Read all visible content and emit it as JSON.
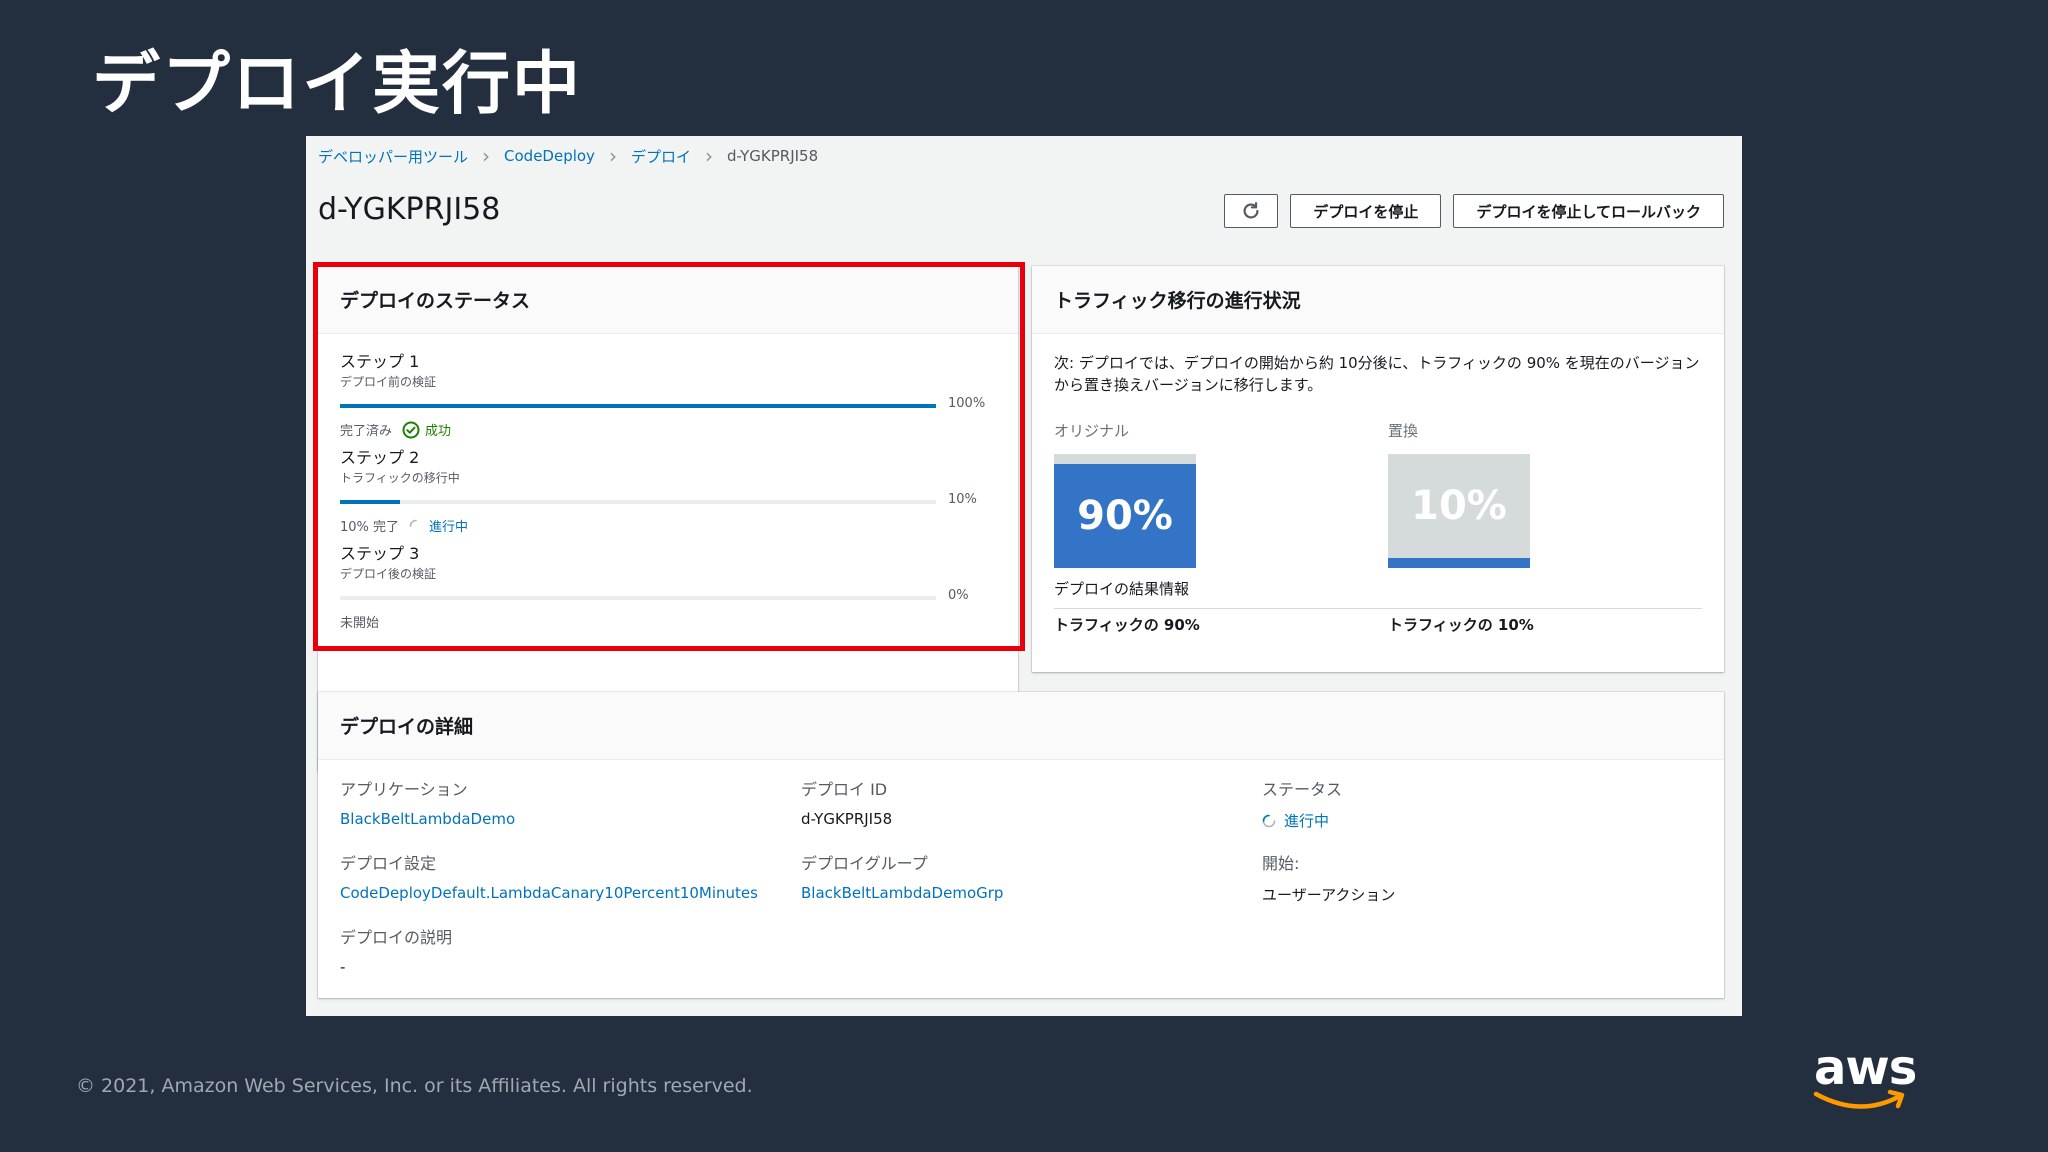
{
  "slide": {
    "title": "デプロイ実行中",
    "copyright": "© 2021, Amazon Web Services, Inc. or its Affiliates. All rights reserved.",
    "logo_text": "aws"
  },
  "breadcrumb": [
    "デベロッパー用ツール",
    "CodeDeploy",
    "デプロイ",
    "d-YGKPRJI58"
  ],
  "page": {
    "title": "d-YGKPRJI58",
    "stop_button": "デプロイを停止",
    "stop_rollback_button": "デプロイを停止してロールバック",
    "refresh_icon": "refresh-icon"
  },
  "status_card": {
    "title": "デプロイのステータス",
    "steps": [
      {
        "name": "ステップ 1",
        "desc": "デプロイ前の検証",
        "progress": 100,
        "pct_label": "100%",
        "state": "完了済み",
        "badge": "成功"
      },
      {
        "name": "ステップ 2",
        "desc": "トラフィックの移行中",
        "progress": 10,
        "pct_label": "10%",
        "state": "10% 完了",
        "badge": "進行中"
      },
      {
        "name": "ステップ 3",
        "desc": "デプロイ後の検証",
        "progress": 0,
        "pct_label": "0%",
        "state": "未開始",
        "badge": ""
      }
    ]
  },
  "traffic_card": {
    "title": "トラフィック移行の進行状況",
    "description": "次: デプロイでは、デプロイの開始から約 10分後に、トラフィックの 90% を現在のバージョンから置き換えバージョンに移行します。",
    "original_label": "オリジナル",
    "replacement_label": "置換",
    "original_pct": "90%",
    "replacement_pct": "10%",
    "result_label": "デプロイの結果情報",
    "original_share": "トラフィックの 90%",
    "replacement_share": "トラフィックの 10%"
  },
  "details_card": {
    "title": "デプロイの詳細",
    "fields": {
      "application_label": "アプリケーション",
      "application_value": "BlackBeltLambdaDemo",
      "deploy_id_label": "デプロイ ID",
      "deploy_id_value": "d-YGKPRJI58",
      "status_label": "ステータス",
      "status_value": "進行中",
      "config_label": "デプロイ設定",
      "config_value": "CodeDeployDefault.LambdaCanary10Percent10Minutes",
      "group_label": "デプロイグループ",
      "group_value": "BlackBeltLambdaDemoGrp",
      "start_label": "開始:",
      "start_value": "ユーザーアクション",
      "desc_label": "デプロイの説明",
      "desc_value": "-"
    }
  },
  "colors": {
    "background": "#232f3e",
    "link": "#0073bb",
    "success": "#1d8102",
    "highlight": "#e7000b",
    "traffic_blue": "#3374c6"
  }
}
